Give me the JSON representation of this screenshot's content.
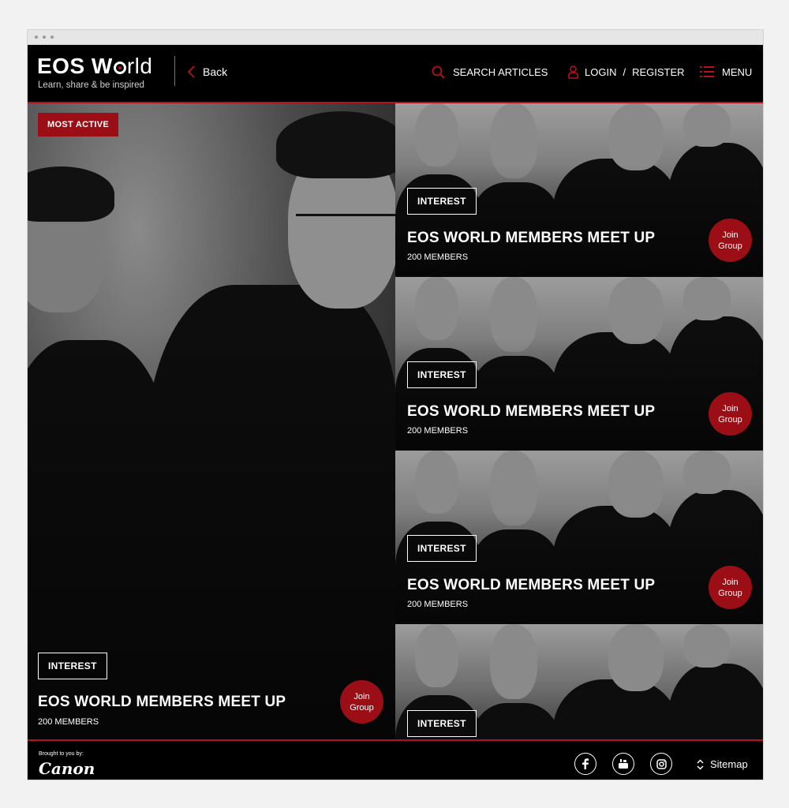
{
  "header": {
    "logo_title": "EOS W",
    "logo_title_rest": "rld",
    "logo_tagline": "Learn, share & be inspired",
    "back_label": "Back",
    "search_label": "SEARCH ARTICLES",
    "login_label": "LOGIN",
    "login_separator": "/",
    "register_label": "REGISTER",
    "menu_label": "MENU"
  },
  "feature": {
    "badge": "MOST ACTIVE",
    "tag": "INTEREST",
    "title": "EOS WORLD MEMBERS MEET UP",
    "members": "200 MEMBERS",
    "join_line1": "Join",
    "join_line2": "Group"
  },
  "cards": [
    {
      "tag": "INTEREST",
      "title": "EOS WORLD MEMBERS MEET UP",
      "members": "200 MEMBERS",
      "join_line1": "Join",
      "join_line2": "Group"
    },
    {
      "tag": "INTEREST",
      "title": "EOS WORLD MEMBERS MEET UP",
      "members": "200 MEMBERS",
      "join_line1": "Join",
      "join_line2": "Group"
    },
    {
      "tag": "INTEREST",
      "title": "EOS WORLD MEMBERS MEET UP",
      "members": "200 MEMBERS",
      "join_line1": "Join",
      "join_line2": "Group"
    },
    {
      "tag": "INTEREST"
    }
  ],
  "footer": {
    "brought_by": "Brought to you by:",
    "brand": "Canon",
    "social_icons": [
      "facebook-icon",
      "youtube-icon",
      "instagram-icon"
    ],
    "sitemap_label": "Sitemap"
  },
  "colors": {
    "accent": "#9b0e15",
    "header_bg": "#000000",
    "divider": "#b5121b"
  }
}
